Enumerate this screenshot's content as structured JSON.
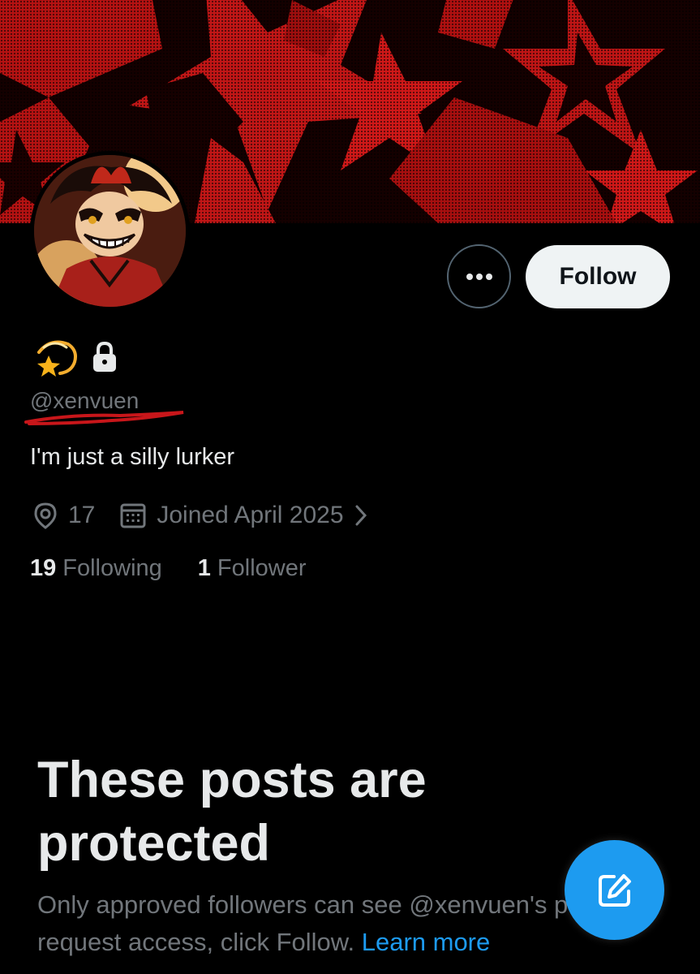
{
  "profile": {
    "handle": "@xenvuen",
    "bio": "I'm just a silly lurker",
    "location": "17",
    "joined": "Joined April 2025",
    "following_count": "19",
    "following_label": "Following",
    "followers_count": "1",
    "followers_label": "Follower",
    "name_emoji": "shooting-star-emoji",
    "protected_icon": "lock-icon"
  },
  "actions": {
    "follow_label": "Follow",
    "more_icon": "more-icon"
  },
  "protected_notice": {
    "title": "These posts are protected",
    "description": "Only approved followers can see @xenvuen's posts. To request access, click Follow.",
    "learn_more": "Learn more"
  },
  "fab": {
    "icon": "compose-icon"
  },
  "colors": {
    "background": "#000000",
    "accent": "#1d9bf0",
    "banner_red": "#c41414",
    "secondary_text": "#71767b",
    "primary_text": "#e7e9ea"
  }
}
